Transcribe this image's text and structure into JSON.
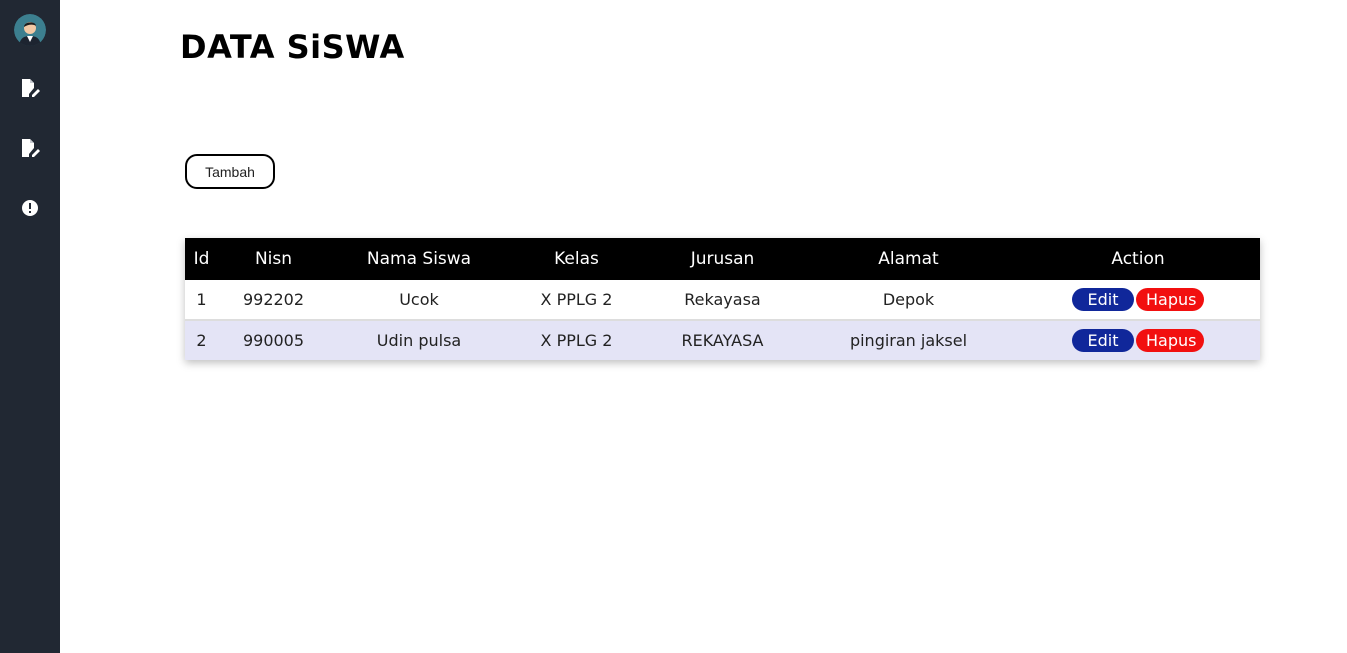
{
  "sidebar": {
    "items": [
      {
        "icon": "file-edit-icon"
      },
      {
        "icon": "file-edit-icon"
      },
      {
        "icon": "alert-circle-icon"
      }
    ]
  },
  "page": {
    "title": "DATA SiSWA",
    "add_label": "Tambah"
  },
  "table": {
    "headers": [
      "Id",
      "Nisn",
      "Nama Siswa",
      "Kelas",
      "Jurusan",
      "Alamat",
      "Action"
    ],
    "rows": [
      {
        "id": "1",
        "nisn": "992202",
        "nama": "Ucok",
        "kelas": "X PPLG 2",
        "jurusan": "Rekayasa",
        "alamat": "Depok",
        "edit": "Edit",
        "hapus": "Hapus"
      },
      {
        "id": "2",
        "nisn": "990005",
        "nama": "Udin pulsa",
        "kelas": "X PPLG 2",
        "jurusan": "REKAYASA",
        "alamat": "pingiran jaksel",
        "edit": "Edit",
        "hapus": "Hapus"
      }
    ]
  },
  "colors": {
    "sidebar": "#212833",
    "header": "#000000",
    "edit": "#10279a",
    "delete": "#f20f0f",
    "row_alt": "#e4e4f6"
  }
}
